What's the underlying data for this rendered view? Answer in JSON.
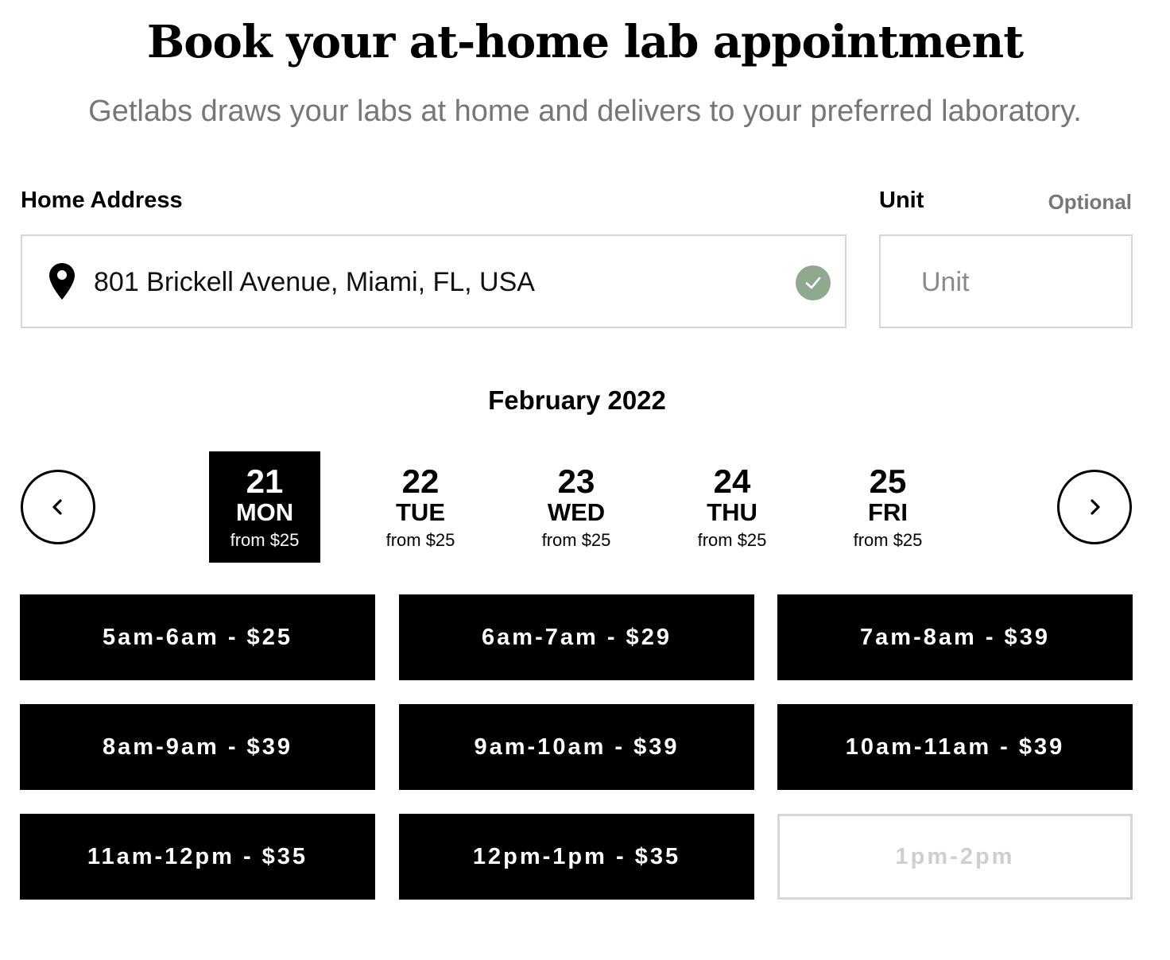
{
  "header": {
    "title": "Book your at-home lab appointment",
    "subtitle": "Getlabs draws your labs at home and delivers to your preferred laboratory."
  },
  "address": {
    "label": "Home Address",
    "value": "801 Brickell Avenue, Miami, FL, USA",
    "icon": "map-pin-icon",
    "status_icon": "check-circle-icon",
    "status_color": "#8fa98f"
  },
  "unit": {
    "label": "Unit",
    "optional_label": "Optional",
    "placeholder": "Unit",
    "value": ""
  },
  "calendar": {
    "month": "February 2022",
    "prev_icon": "chevron-left-icon",
    "next_icon": "chevron-right-icon",
    "days": [
      {
        "num": "21",
        "name": "MON",
        "price": "from $25",
        "selected": true
      },
      {
        "num": "22",
        "name": "TUE",
        "price": "from $25",
        "selected": false
      },
      {
        "num": "23",
        "name": "WED",
        "price": "from $25",
        "selected": false
      },
      {
        "num": "24",
        "name": "THU",
        "price": "from $25",
        "selected": false
      },
      {
        "num": "25",
        "name": "FRI",
        "price": "from $25",
        "selected": false
      }
    ]
  },
  "slots": [
    {
      "label": "5am-6am - $25",
      "available": true
    },
    {
      "label": "6am-7am - $29",
      "available": true
    },
    {
      "label": "7am-8am - $39",
      "available": true
    },
    {
      "label": "8am-9am - $39",
      "available": true
    },
    {
      "label": "9am-10am - $39",
      "available": true
    },
    {
      "label": "10am-11am - $39",
      "available": true
    },
    {
      "label": "11am-12pm - $35",
      "available": true
    },
    {
      "label": "12pm-1pm - $35",
      "available": true
    },
    {
      "label": "1pm-2pm",
      "available": false
    }
  ]
}
